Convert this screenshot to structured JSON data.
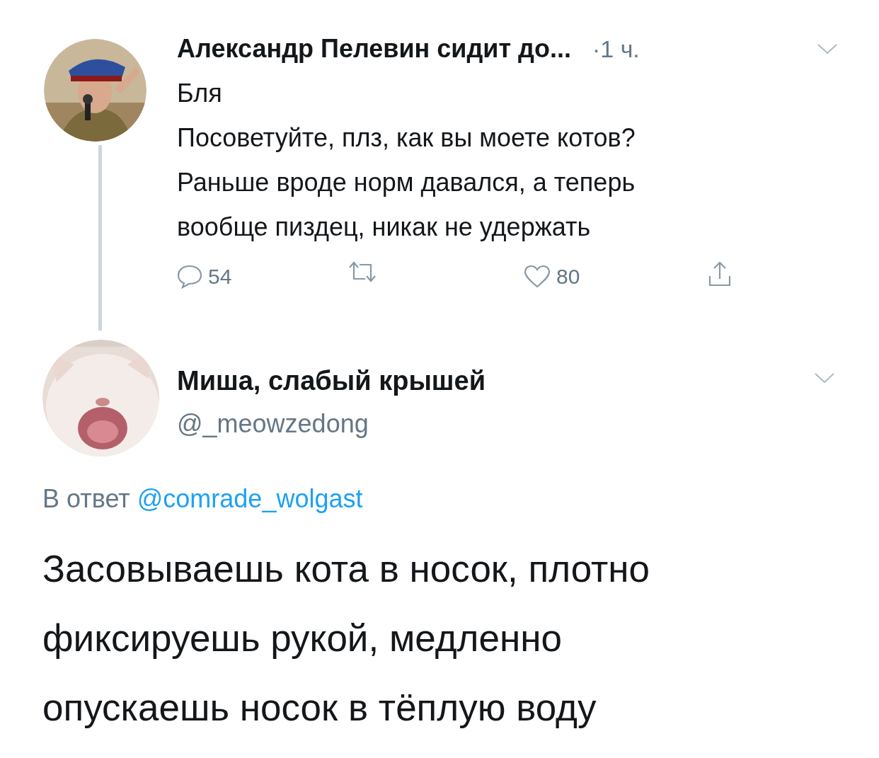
{
  "parent_tweet": {
    "author": "Александр Пелевин сидит до...",
    "time": "·1 ч.",
    "text": "Бля\nПосоветуйте, плз, как вы моете котов?\nРаньше вроде норм давался, а теперь\nвообще пиздец, никак не удержать",
    "actions": [
      {
        "kind": "reply",
        "count": "54"
      },
      {
        "kind": "retweet"
      },
      {
        "kind": "like",
        "count": "80"
      },
      {
        "kind": "share"
      }
    ]
  },
  "main_tweet": {
    "author": "Миша, слабый крышей",
    "handle": "@_meowzedong",
    "reply_prefix": "В ответ",
    "reply_to": "@comrade_wolgast",
    "text": "Засовываешь кота в носок, плотно\nфиксируешь рукой, медленно\nопускаешь носок в тёплую воду"
  }
}
